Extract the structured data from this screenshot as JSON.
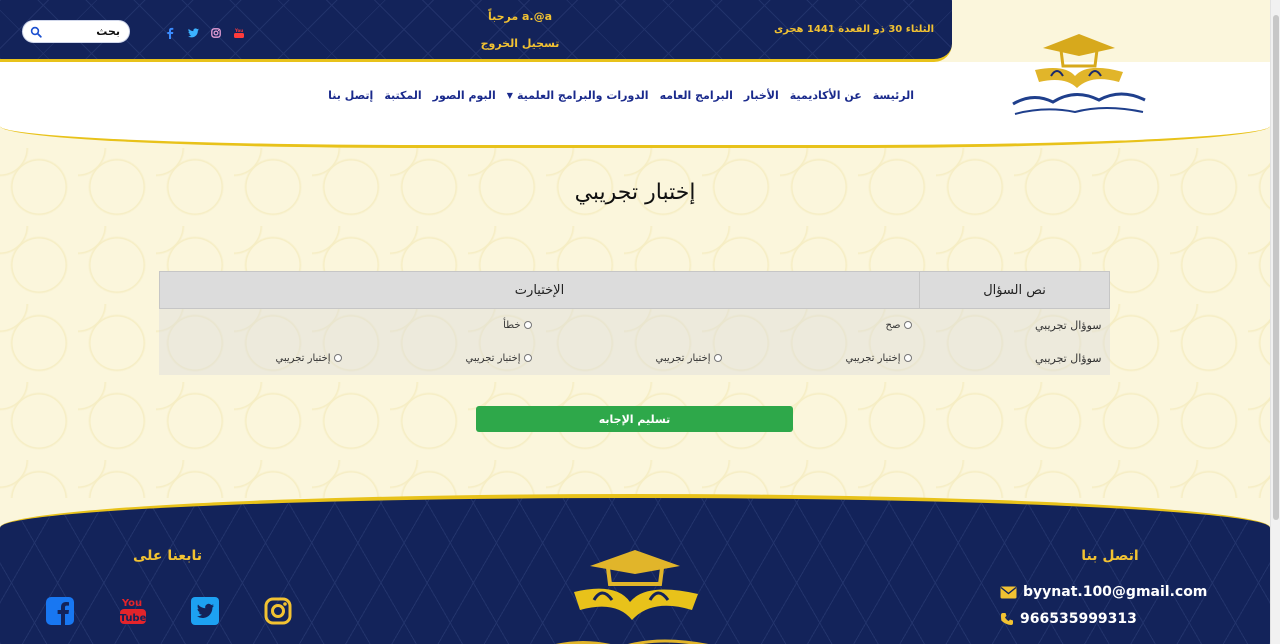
{
  "header": {
    "date": "الثلثاء 30 ذو القعدة 1441 هجرى",
    "welcome": "مرحباً a.@a",
    "logout_label": "تسجيل الخروج",
    "search_placeholder": "بحث"
  },
  "social_top": [
    "youtube-icon",
    "instagram-icon",
    "twitter-icon",
    "facebook-icon"
  ],
  "nav": {
    "items": [
      {
        "label": "الرئيسة"
      },
      {
        "label": "عن الأكاديمية"
      },
      {
        "label": "الأخبار"
      },
      {
        "label": "البرامج العامه"
      },
      {
        "label": "الدورات والبرامج العلمية",
        "dropdown": true
      },
      {
        "label": "البوم الصور"
      },
      {
        "label": "المكتبة"
      },
      {
        "label": "إتصل بنا"
      }
    ]
  },
  "main": {
    "title": "إختبار تجريبي",
    "table": {
      "headers": [
        "نص السؤال",
        "الإختيارت"
      ],
      "rows": [
        {
          "question": "سوؤال تجريبي",
          "options": [
            "صح",
            "خطأ"
          ]
        },
        {
          "question": "سوؤال تجريبي",
          "options": [
            "إختبار تجريبي",
            "إختبار تجريبي",
            "إختبار تجريبي",
            "إختبار تجريبي"
          ]
        }
      ]
    },
    "submit_label": "تسليم الإجابه"
  },
  "footer": {
    "contact_title": "اتصل بنا",
    "email": "byynat.100@gmail.com",
    "phone": "966535999313",
    "follow_title": "تابعنا على",
    "social": [
      "instagram-icon",
      "twitter-icon",
      "youtube-icon",
      "facebook-icon"
    ]
  },
  "colors": {
    "navy": "#13235a",
    "gold": "#e8c21a",
    "nav_link": "#1a2a8c",
    "submit_green": "#2ea84a",
    "page_bg": "#fbf6dc"
  }
}
